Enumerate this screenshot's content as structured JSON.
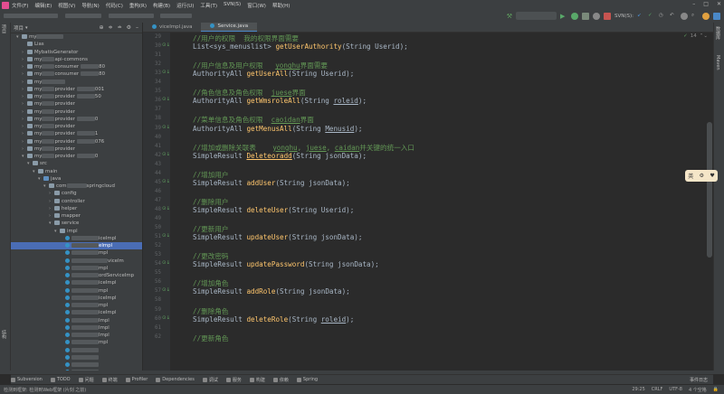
{
  "menu": [
    "文件(F)",
    "编辑(E)",
    "视图(V)",
    "导航(N)",
    "代码(C)",
    "重构(R)",
    "构建(B)",
    "运行(U)",
    "工具(T)",
    "SVN(S)",
    "窗口(W)",
    "帮助(H)"
  ],
  "toolbar": {
    "svn_label": "SVN(S):"
  },
  "project": {
    "header": "项目",
    "rows": [
      {
        "indent": 1,
        "arrow": "▾",
        "icon": "fold",
        "label": "my",
        "blur": 30
      },
      {
        "indent": 2,
        "arrow": "",
        "icon": "fold",
        "label": "Lias",
        "blur": 0
      },
      {
        "indent": 2,
        "arrow": "›",
        "icon": "fold",
        "label": "MybatisGenerator",
        "blur": 0
      },
      {
        "indent": 2,
        "arrow": "›",
        "icon": "fold",
        "label": "my",
        "blur": 14,
        "suffix": "api-commons"
      },
      {
        "indent": 2,
        "arrow": "›",
        "icon": "fold",
        "label": "my",
        "blur": 14,
        "suffix": "consumer",
        "suffix2": "80"
      },
      {
        "indent": 2,
        "arrow": "›",
        "icon": "fold",
        "label": "my",
        "blur": 14,
        "suffix": "consumer",
        "suffix2": "80"
      },
      {
        "indent": 2,
        "arrow": "›",
        "icon": "fold",
        "label": "my",
        "blur": 26,
        "suffix": ""
      },
      {
        "indent": 2,
        "arrow": "›",
        "icon": "fold",
        "label": "my",
        "blur": 14,
        "suffix": "provider",
        "suffix2": "001"
      },
      {
        "indent": 2,
        "arrow": "›",
        "icon": "fold",
        "label": "my",
        "blur": 14,
        "suffix": "provider",
        "suffix2": "50"
      },
      {
        "indent": 2,
        "arrow": "›",
        "icon": "fold",
        "label": "my",
        "blur": 14,
        "suffix": "provider",
        "suffix2": ""
      },
      {
        "indent": 2,
        "arrow": "›",
        "icon": "fold",
        "label": "my",
        "blur": 14,
        "suffix": "provider",
        "suffix2": ""
      },
      {
        "indent": 2,
        "arrow": "›",
        "icon": "fold",
        "label": "my",
        "blur": 14,
        "suffix": "provider",
        "suffix2": "0"
      },
      {
        "indent": 2,
        "arrow": "›",
        "icon": "fold",
        "label": "my",
        "blur": 14,
        "suffix": "provider",
        "suffix2": ""
      },
      {
        "indent": 2,
        "arrow": "›",
        "icon": "fold",
        "label": "my",
        "blur": 14,
        "suffix": "provider",
        "suffix2": "1"
      },
      {
        "indent": 2,
        "arrow": "›",
        "icon": "fold",
        "label": "my",
        "blur": 14,
        "suffix": "provider",
        "suffix2": "076"
      },
      {
        "indent": 2,
        "arrow": "›",
        "icon": "fold",
        "label": "my",
        "blur": 14,
        "suffix": "provider",
        "suffix2": ""
      },
      {
        "indent": 2,
        "arrow": "▾",
        "icon": "fold",
        "label": "my",
        "blur": 14,
        "suffix": "provider",
        "suffix2": "0"
      },
      {
        "indent": 3,
        "arrow": "▾",
        "icon": "fold",
        "label": "src",
        "blur": 0
      },
      {
        "indent": 4,
        "arrow": "▾",
        "icon": "fold",
        "label": "main",
        "blur": 0
      },
      {
        "indent": 5,
        "arrow": "▾",
        "icon": "fold blue",
        "label": "java",
        "blur": 0
      },
      {
        "indent": 6,
        "arrow": "▾",
        "icon": "fold",
        "label": "com",
        "blur": 22,
        "suffix": "springcloud"
      },
      {
        "indent": 7,
        "arrow": "›",
        "icon": "fold",
        "label": "config",
        "blur": 0
      },
      {
        "indent": 7,
        "arrow": "›",
        "icon": "fold",
        "label": "controller",
        "blur": 0
      },
      {
        "indent": 7,
        "arrow": "›",
        "icon": "fold",
        "label": "helper",
        "blur": 0
      },
      {
        "indent": 7,
        "arrow": "›",
        "icon": "fold",
        "label": "mapper",
        "blur": 0
      },
      {
        "indent": 7,
        "arrow": "▾",
        "icon": "fold",
        "label": "service",
        "blur": 0
      },
      {
        "indent": 8,
        "arrow": "▾",
        "icon": "fold",
        "label": "impl",
        "blur": 0
      },
      {
        "indent": 9,
        "arrow": "",
        "icon": "cls",
        "label": "",
        "blur": 30,
        "suffix": "iceImpl"
      },
      {
        "indent": 9,
        "arrow": "",
        "icon": "cls",
        "label": "",
        "blur": 30,
        "suffix": "eImpl",
        "sel": true
      },
      {
        "indent": 9,
        "arrow": "",
        "icon": "cls",
        "label": "",
        "blur": 30,
        "suffix": "mpl"
      },
      {
        "indent": 9,
        "arrow": "",
        "icon": "cls",
        "label": "",
        "blur": 40,
        "suffix": "viceIm"
      },
      {
        "indent": 9,
        "arrow": "",
        "icon": "cls",
        "label": "",
        "blur": 30,
        "suffix": "mpl"
      },
      {
        "indent": 9,
        "arrow": "",
        "icon": "cls",
        "label": "",
        "blur": 30,
        "suffix": "ordServiceImp"
      },
      {
        "indent": 9,
        "arrow": "",
        "icon": "cls",
        "label": "",
        "blur": 30,
        "suffix": "iceImpl"
      },
      {
        "indent": 9,
        "arrow": "",
        "icon": "cls",
        "label": "",
        "blur": 30,
        "suffix": "mpl"
      },
      {
        "indent": 9,
        "arrow": "",
        "icon": "cls",
        "label": "",
        "blur": 30,
        "suffix": "iceImpl"
      },
      {
        "indent": 9,
        "arrow": "",
        "icon": "cls",
        "label": "",
        "blur": 30,
        "suffix": "mpl"
      },
      {
        "indent": 9,
        "arrow": "",
        "icon": "cls",
        "label": "",
        "blur": 30,
        "suffix": "iceImpl"
      },
      {
        "indent": 9,
        "arrow": "",
        "icon": "cls",
        "label": "",
        "blur": 30,
        "suffix": "Impl"
      },
      {
        "indent": 9,
        "arrow": "",
        "icon": "cls",
        "label": "",
        "blur": 30,
        "suffix": "Impl"
      },
      {
        "indent": 9,
        "arrow": "",
        "icon": "cls",
        "label": "",
        "blur": 30,
        "suffix": "Impl"
      },
      {
        "indent": 9,
        "arrow": "",
        "icon": "cls",
        "label": "",
        "blur": 30,
        "suffix": "mpl"
      },
      {
        "indent": 9,
        "arrow": "",
        "icon": "cls",
        "label": "",
        "blur": 30,
        "suffix": ""
      },
      {
        "indent": 9,
        "arrow": "",
        "icon": "cls",
        "label": "",
        "blur": 30,
        "suffix": ""
      },
      {
        "indent": 9,
        "arrow": "",
        "icon": "cls",
        "label": "",
        "blur": 30,
        "suffix": ""
      },
      {
        "indent": 9,
        "arrow": "",
        "icon": "cls",
        "label": "",
        "blur": 30,
        "suffix": ""
      },
      {
        "indent": 9,
        "arrow": "",
        "icon": "cls",
        "label": "",
        "blur": 30,
        "suffix": "mpl"
      }
    ]
  },
  "tabs": [
    {
      "label": "viceImpl.java",
      "active": false
    },
    {
      "label": "Service.java",
      "active": true
    }
  ],
  "editor": {
    "indicator": "14",
    "lines": [
      {
        "n": "29",
        "g": "",
        "segs": [
          [
            "cm",
            "//用户的权限  我的权限界面需要"
          ]
        ]
      },
      {
        "n": "30",
        "g": "⊙↓",
        "segs": [
          [
            "",
            "List<sys_menuslist> "
          ],
          [
            "fn",
            "getUserAuthority"
          ],
          [
            "",
            "(String Userid);"
          ]
        ],
        "hlmark": true
      },
      {
        "n": "31",
        "g": "",
        "segs": []
      },
      {
        "n": "32",
        "g": "",
        "segs": [
          [
            "cm",
            "//用户信息及用户权限   "
          ],
          [
            "cm-u",
            "yonghu"
          ],
          [
            "cm",
            "界面需要"
          ]
        ]
      },
      {
        "n": "33",
        "g": "⊙↓",
        "segs": [
          [
            "",
            "AuthorityAll "
          ],
          [
            "fn",
            "getUserAll"
          ],
          [
            "",
            "(String Userid);"
          ]
        ]
      },
      {
        "n": "34",
        "g": "",
        "segs": []
      },
      {
        "n": "35",
        "g": "",
        "segs": [
          [
            "cm",
            "//角色信息及角色权限  "
          ],
          [
            "cm-u",
            "juese"
          ],
          [
            "cm",
            "界面"
          ]
        ]
      },
      {
        "n": "36",
        "g": "⊙↓",
        "segs": [
          [
            "",
            "AuthorityAll "
          ],
          [
            "fn",
            "getWmsroleAll"
          ],
          [
            "",
            "(String "
          ],
          [
            "pm-u",
            "roleid"
          ],
          [
            "",
            "); "
          ]
        ]
      },
      {
        "n": "37",
        "g": "",
        "segs": []
      },
      {
        "n": "38",
        "g": "",
        "segs": [
          [
            "cm",
            "//菜单信息及角色权限  "
          ],
          [
            "cm-u",
            "caoidan"
          ],
          [
            "cm",
            "界面"
          ]
        ]
      },
      {
        "n": "39",
        "g": "⊙↓",
        "segs": [
          [
            "",
            "AuthorityAll "
          ],
          [
            "fn",
            "getMenusAll"
          ],
          [
            "",
            "(String "
          ],
          [
            "pm-u",
            "Menusid"
          ],
          [
            "",
            "); "
          ]
        ]
      },
      {
        "n": "40",
        "g": "",
        "segs": []
      },
      {
        "n": "41",
        "g": "",
        "segs": [
          [
            "cm",
            "//增加或删除关联表    "
          ],
          [
            "cm-u",
            "yonghu"
          ],
          [
            "cm",
            ", "
          ],
          [
            "cm-u",
            "juese"
          ],
          [
            "cm",
            ", "
          ],
          [
            "cm-u",
            "caidan"
          ],
          [
            "cm",
            "并关键的统一入口"
          ]
        ]
      },
      {
        "n": "42",
        "g": "⊙↓",
        "segs": [
          [
            "",
            "SimpleResult "
          ],
          [
            "fn-u",
            "Deleteoradd"
          ],
          [
            "",
            "(String jsonData);"
          ]
        ]
      },
      {
        "n": "43",
        "g": "",
        "segs": []
      },
      {
        "n": "44",
        "g": "",
        "segs": [
          [
            "cm",
            "//增加用户"
          ]
        ]
      },
      {
        "n": "45",
        "g": "⊙↓",
        "segs": [
          [
            "",
            "SimpleResult "
          ],
          [
            "fn",
            "addUser"
          ],
          [
            "",
            "(String jsonData);"
          ]
        ]
      },
      {
        "n": "46",
        "g": "",
        "segs": []
      },
      {
        "n": "47",
        "g": "",
        "segs": [
          [
            "cm",
            "//删除用户"
          ]
        ]
      },
      {
        "n": "48",
        "g": "⊙↓",
        "segs": [
          [
            "",
            "SimpleResult "
          ],
          [
            "fn",
            "deleteUser"
          ],
          [
            "",
            "(String Userid);"
          ]
        ]
      },
      {
        "n": "49",
        "g": "",
        "segs": []
      },
      {
        "n": "50",
        "g": "",
        "segs": [
          [
            "cm",
            "//更新用户"
          ]
        ]
      },
      {
        "n": "51",
        "g": "⊙↓",
        "segs": [
          [
            "",
            "SimpleResult "
          ],
          [
            "fn",
            "updateUser"
          ],
          [
            "",
            "(String jsonData);"
          ]
        ]
      },
      {
        "n": "52",
        "g": "",
        "segs": []
      },
      {
        "n": "53",
        "g": "",
        "segs": [
          [
            "cm",
            "//更改密码"
          ]
        ]
      },
      {
        "n": "54",
        "g": "⊙↓",
        "segs": [
          [
            "",
            "SimpleResult "
          ],
          [
            "fn",
            "updatePassword"
          ],
          [
            "",
            "(String jsonData);"
          ]
        ]
      },
      {
        "n": "55",
        "g": "",
        "segs": []
      },
      {
        "n": "56",
        "g": "",
        "segs": [
          [
            "cm",
            "//增加角色"
          ]
        ]
      },
      {
        "n": "57",
        "g": "⊙↓",
        "segs": [
          [
            "",
            "SimpleResult "
          ],
          [
            "fn",
            "addRole"
          ],
          [
            "",
            "(String jsonData);"
          ]
        ]
      },
      {
        "n": "58",
        "g": "",
        "segs": []
      },
      {
        "n": "59",
        "g": "",
        "segs": [
          [
            "cm",
            "//删除角色"
          ]
        ]
      },
      {
        "n": "60",
        "g": "⊙↓",
        "segs": [
          [
            "",
            "SimpleResult "
          ],
          [
            "fn",
            "deleteRole"
          ],
          [
            "",
            "(String "
          ],
          [
            "pm-u",
            "roleid"
          ],
          [
            "",
            "); "
          ]
        ]
      },
      {
        "n": "61",
        "g": "",
        "segs": []
      },
      {
        "n": "62",
        "g": "",
        "segs": [
          [
            "cm",
            "//更新角色"
          ]
        ]
      }
    ]
  },
  "float_panel": {
    "text": "英"
  },
  "bottom_tabs": [
    "Subversion",
    "TODO",
    "问题",
    "终端",
    "Profiler",
    "Dependencies",
    "调试",
    "服务",
    "构建",
    "依赖",
    "Spring"
  ],
  "event_log": "事件日志",
  "status": {
    "message": "检测到框架: 检测到Web框架 (片刻 之前)",
    "position": "29:25",
    "line_sep": "CRLF",
    "encoding": "UTF-8",
    "indent": "4 个空格"
  }
}
